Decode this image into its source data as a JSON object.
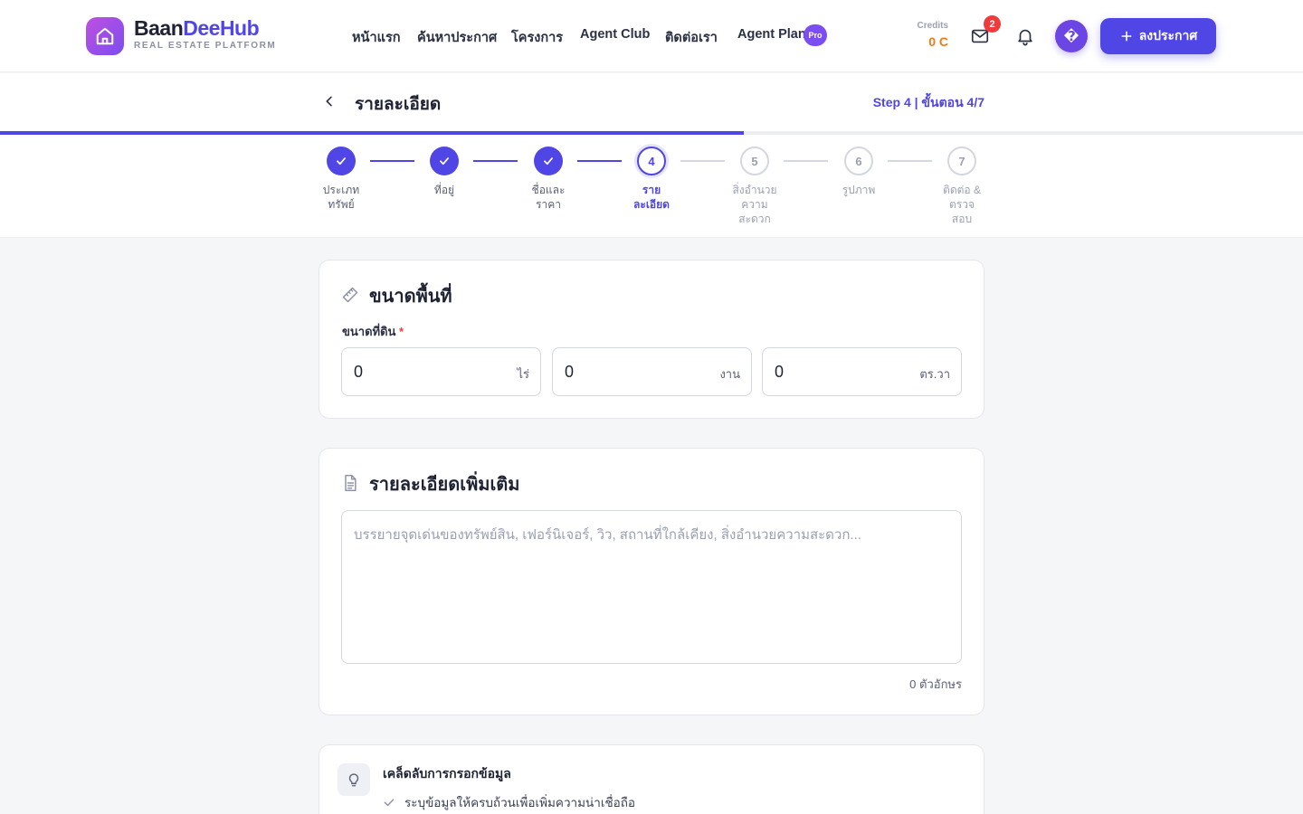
{
  "brand": {
    "name_part1": "Baan",
    "name_part2": "DeeHub",
    "tagline": "REAL ESTATE PLATFORM"
  },
  "nav": {
    "items": [
      "หน้าแรก",
      "ค้นหาประกาศ",
      "โครงการ",
      "Agent Club",
      "ติดต่อเรา",
      "Agent Plan"
    ],
    "pro_badge": "Pro"
  },
  "credits": {
    "label": "Credits",
    "value": "0 C"
  },
  "notifications": {
    "mail_count": "2"
  },
  "avatar": {
    "glyph": "�"
  },
  "post_button": {
    "label": "ลงประกาศ"
  },
  "page": {
    "title": "รายละเอียด",
    "step_indicator": "Step 4 | ขั้นตอน 4/7",
    "progress": 0.571
  },
  "steps": [
    {
      "number": "1",
      "label": "ประเภททรัพย์",
      "status": "done"
    },
    {
      "number": "2",
      "label": "ที่อยู่",
      "status": "done"
    },
    {
      "number": "3",
      "label": "ชื่อและราคา",
      "status": "done"
    },
    {
      "number": "4",
      "label": "รายละเอียด",
      "status": "active"
    },
    {
      "number": "5",
      "label": "สิ่งอำนวยความสะดวก",
      "status": "todo"
    },
    {
      "number": "6",
      "label": "รูปภาพ",
      "status": "todo"
    },
    {
      "number": "7",
      "label": "ติดต่อ & ตรวจสอบ",
      "status": "todo"
    }
  ],
  "step_label_lines": [
    [
      "ประเภท",
      "ทรัพย์"
    ],
    [
      "ที่อยู่"
    ],
    [
      "ชื่อและ",
      "ราคา"
    ],
    [
      "ราย",
      "ละเอียด"
    ],
    [
      "สิ่งอำนวย",
      "ความ",
      "สะดวก"
    ],
    [
      "รูปภาพ"
    ],
    [
      "ติดต่อ &",
      "ตรวจ",
      "สอบ"
    ]
  ],
  "area_section": {
    "title": "ขนาดพื้นที่",
    "field_label": "ขนาดที่ดิน",
    "required_mark": "*",
    "inputs": [
      {
        "value": "0",
        "unit": "ไร่"
      },
      {
        "value": "0",
        "unit": "งาน"
      },
      {
        "value": "0",
        "unit": "ตร.วา"
      }
    ]
  },
  "details_section": {
    "title": "รายละเอียดเพิ่มเติม",
    "placeholder": "บรรยายจุดเด่นของทรัพย์สิน, เฟอร์นิเจอร์, วิว, สถานที่ใกล้เคียง, สิ่งอำนวยความสะดวก...",
    "char_count": "0 ตัวอักษร"
  },
  "tips": {
    "title": "เคล็ดลับการกรอกข้อมูล",
    "items": [
      "ระบุข้อมูลให้ครบถ้วนเพื่อเพิ่มความน่าเชื่อถือ"
    ]
  },
  "colors": {
    "primary": "#4f46e5",
    "credits": "#f07a16",
    "badge": "#ef3b3b"
  }
}
